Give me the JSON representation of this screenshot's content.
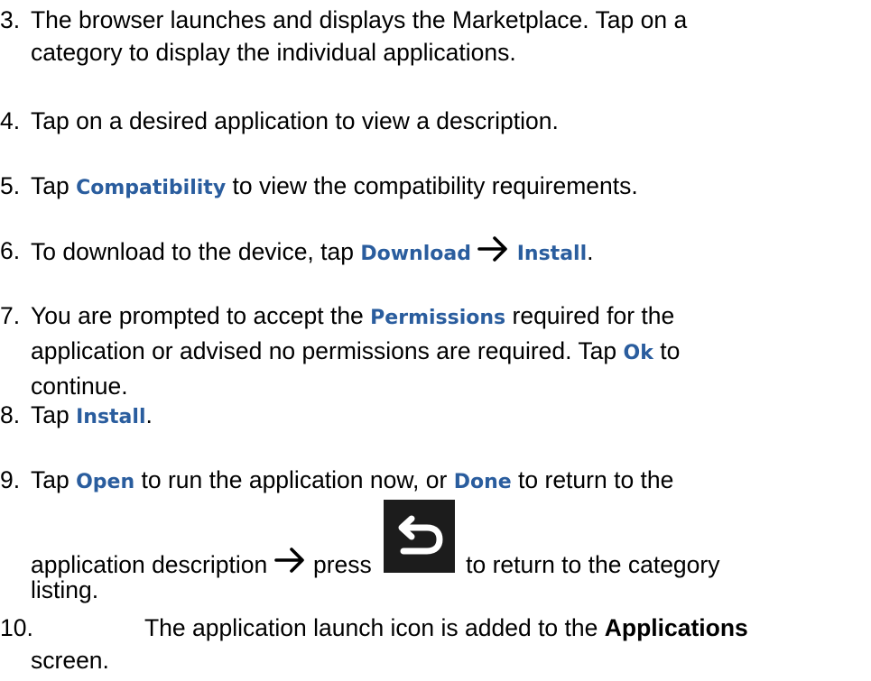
{
  "steps": {
    "s3": {
      "num": "3.",
      "line1": "The browser launches and displays the Marketplace. Tap on a",
      "line2": "category to display the individual applications."
    },
    "s4": {
      "num": "4.",
      "text": "Tap on a desired application to view a description."
    },
    "s5": {
      "num": "5.",
      "pre": "Tap ",
      "kw": "Compatibility",
      "post": " to view the compatibility requirements."
    },
    "s6": {
      "num": "6.",
      "pre": "To download to the device, tap ",
      "kw1": "Download",
      "kw2": "Install",
      "post": "."
    },
    "s7": {
      "num": "7.",
      "pre": "You are prompted to accept the ",
      "kw1": "Permissions",
      "mid1": " required for the",
      "line2pre": "application or advised no permissions are required. Tap ",
      "kw2": "Ok",
      "mid2": " to",
      "line3": "continue."
    },
    "s8": {
      "num": "8.",
      "pre": "Tap ",
      "kw": "Install",
      "post": "."
    },
    "s9": {
      "num": "9.",
      "pre": "Tap ",
      "kw1": "Open",
      "mid": " to run the application now, or ",
      "kw2": "Done",
      "post": " to return to the",
      "line2pre": "application description ",
      "line2mid": " press ",
      "line2post": "to return to the category",
      "line3": "listing."
    },
    "s10": {
      "num": "10.",
      "pre": "The application launch icon is added to the ",
      "kw": "Applications",
      "line2": "screen."
    }
  },
  "icons": {
    "arrow": "right-arrow-icon",
    "back": "back-icon"
  },
  "colors": {
    "keyword": "#2a5d9e",
    "back_button_bg": "#1c1c1c"
  }
}
